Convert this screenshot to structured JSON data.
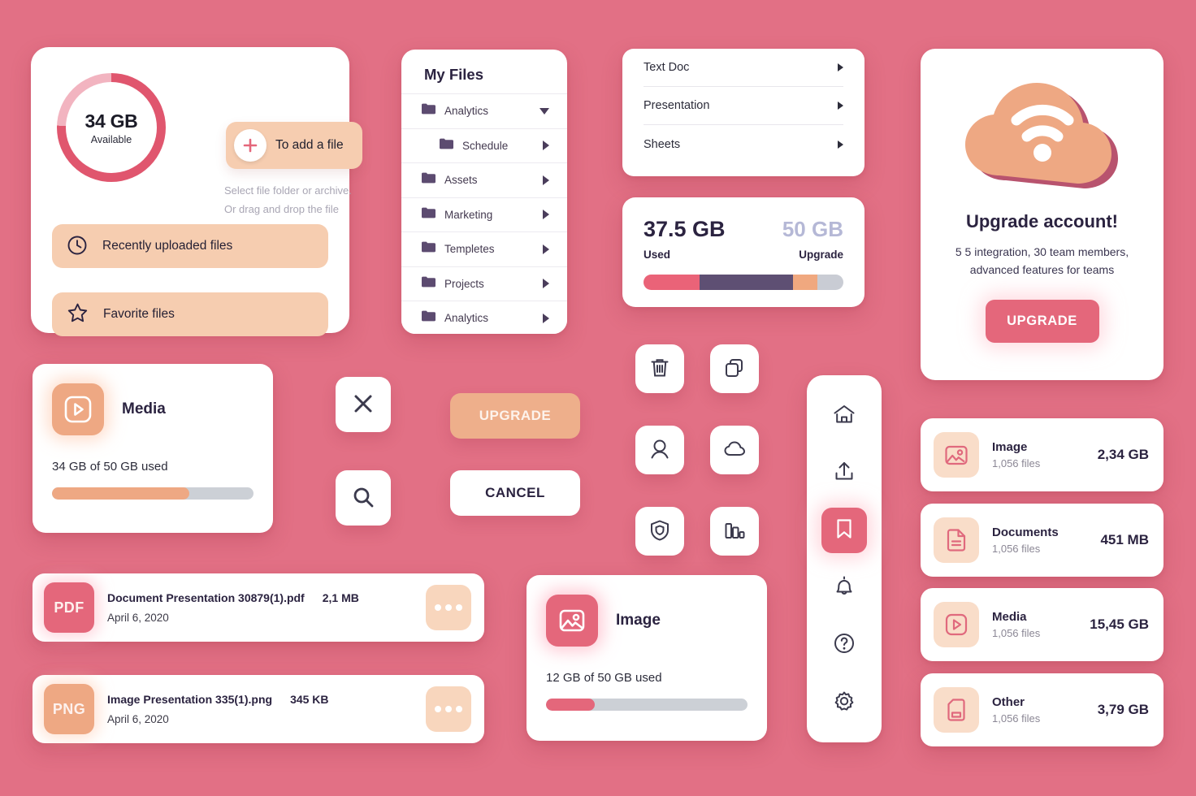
{
  "colors": {
    "background": "#e27085",
    "accent_pink": "#e4677b",
    "accent_peach": "#eea883",
    "soft_peach": "#f6cdb0",
    "dark_purple": "#5e4f73",
    "text_dark": "#2b2340",
    "muted": "#a9a6b4",
    "track_gray": "#c9ccd4"
  },
  "overview": {
    "donut": {
      "value": "34 GB",
      "caption": "Available",
      "percent": 75
    },
    "add_file_label": "To add a file",
    "plus_icon": "plus-icon",
    "hint_line_1": "Select file folder or archive.",
    "hint_line_2": "Or drag and drop the file",
    "rows": [
      {
        "label": "Recently uploaded files",
        "icon": "clock-icon"
      },
      {
        "label": "Favorite files",
        "icon": "star-icon"
      }
    ]
  },
  "my_files": {
    "title": "My Files",
    "items": [
      {
        "label": "Analytics",
        "icon": "folder-icon",
        "indent": false,
        "caret": "chevron-down-icon"
      },
      {
        "label": "Schedule",
        "icon": "folder-icon",
        "indent": true,
        "caret": "chevron-right-icon"
      },
      {
        "label": "Assets",
        "icon": "folder-icon",
        "indent": false,
        "caret": "chevron-right-icon"
      },
      {
        "label": "Marketing",
        "icon": "folder-icon",
        "indent": false,
        "caret": "chevron-right-icon"
      },
      {
        "label": "Templetes",
        "icon": "folder-icon",
        "indent": false,
        "caret": "chevron-right-icon"
      },
      {
        "label": "Projects",
        "icon": "folder-icon",
        "indent": false,
        "caret": "chevron-right-icon"
      },
      {
        "label": "Analytics",
        "icon": "folder-icon",
        "indent": false,
        "caret": "chevron-right-icon"
      }
    ]
  },
  "doc_types": {
    "items": [
      {
        "label": "Text Doc",
        "caret": "chevron-right-icon"
      },
      {
        "label": "Presentation",
        "caret": "chevron-right-icon"
      },
      {
        "label": "Sheets",
        "caret": "chevron-right-icon"
      }
    ]
  },
  "meter": {
    "used_value": "37.5 GB",
    "total_value": "50 GB",
    "used_caption": "Used",
    "total_caption": "Upgrade",
    "segments": [
      {
        "name": "used-pink",
        "percent": 28,
        "color": "#ea6378"
      },
      {
        "name": "used-purple",
        "percent": 47,
        "color": "#5e4f73"
      },
      {
        "name": "upgrade-peach",
        "percent": 12,
        "color": "#f0a87f"
      },
      {
        "name": "free-gray",
        "percent": 13,
        "color": "#c9ccd4"
      }
    ]
  },
  "upgrade_card": {
    "icon": "cloud-wifi-icon",
    "title": "Upgrade account!",
    "description": "5 5 integration, 30 team members, advanced features for teams",
    "cta_label": "UPGRADE"
  },
  "media_card": {
    "icon": "play-icon",
    "title": "Media",
    "usage_text": "34 GB of 50 GB used",
    "percent": 68
  },
  "image_card": {
    "icon": "image-icon",
    "title": "Image",
    "usage_text": "12 GB of 50 GB used",
    "percent": 24
  },
  "buttons": {
    "close_icon": "close-icon",
    "search_icon": "search-icon",
    "upgrade_label": "UPGRADE",
    "cancel_label": "CANCEL"
  },
  "icon_grid": [
    {
      "name": "trash-icon"
    },
    {
      "name": "copy-icon"
    },
    {
      "name": "user-icon"
    },
    {
      "name": "cloud-icon"
    },
    {
      "name": "shield-icon"
    },
    {
      "name": "bar-chart-icon"
    }
  ],
  "nav_rail": [
    {
      "name": "home-icon",
      "active": false
    },
    {
      "name": "upload-icon",
      "active": false
    },
    {
      "name": "bookmark-icon",
      "active": true
    },
    {
      "name": "bell-icon",
      "active": false
    },
    {
      "name": "help-icon",
      "active": false
    },
    {
      "name": "settings-icon",
      "active": false
    }
  ],
  "file_rows": [
    {
      "ext": "PDF",
      "name": "Document Presentation 30879(1).pdf",
      "size": "2,1 MB",
      "date": "April 6, 2020",
      "more_icon": "more-icon"
    },
    {
      "ext": "PNG",
      "name": "Image Presentation 335(1).png",
      "size": "345 KB",
      "date": "April 6, 2020",
      "more_icon": "more-icon"
    }
  ],
  "categories": [
    {
      "icon": "image-icon",
      "name": "Image",
      "files": "1,056 files",
      "size": "2,34 GB"
    },
    {
      "icon": "document-icon",
      "name": "Documents",
      "files": "1,056 files",
      "size": "451 MB"
    },
    {
      "icon": "play-icon",
      "name": "Media",
      "files": "1,056 files",
      "size": "15,45 GB"
    },
    {
      "icon": "file-icon",
      "name": "Other",
      "files": "1,056 files",
      "size": "3,79 GB"
    }
  ]
}
